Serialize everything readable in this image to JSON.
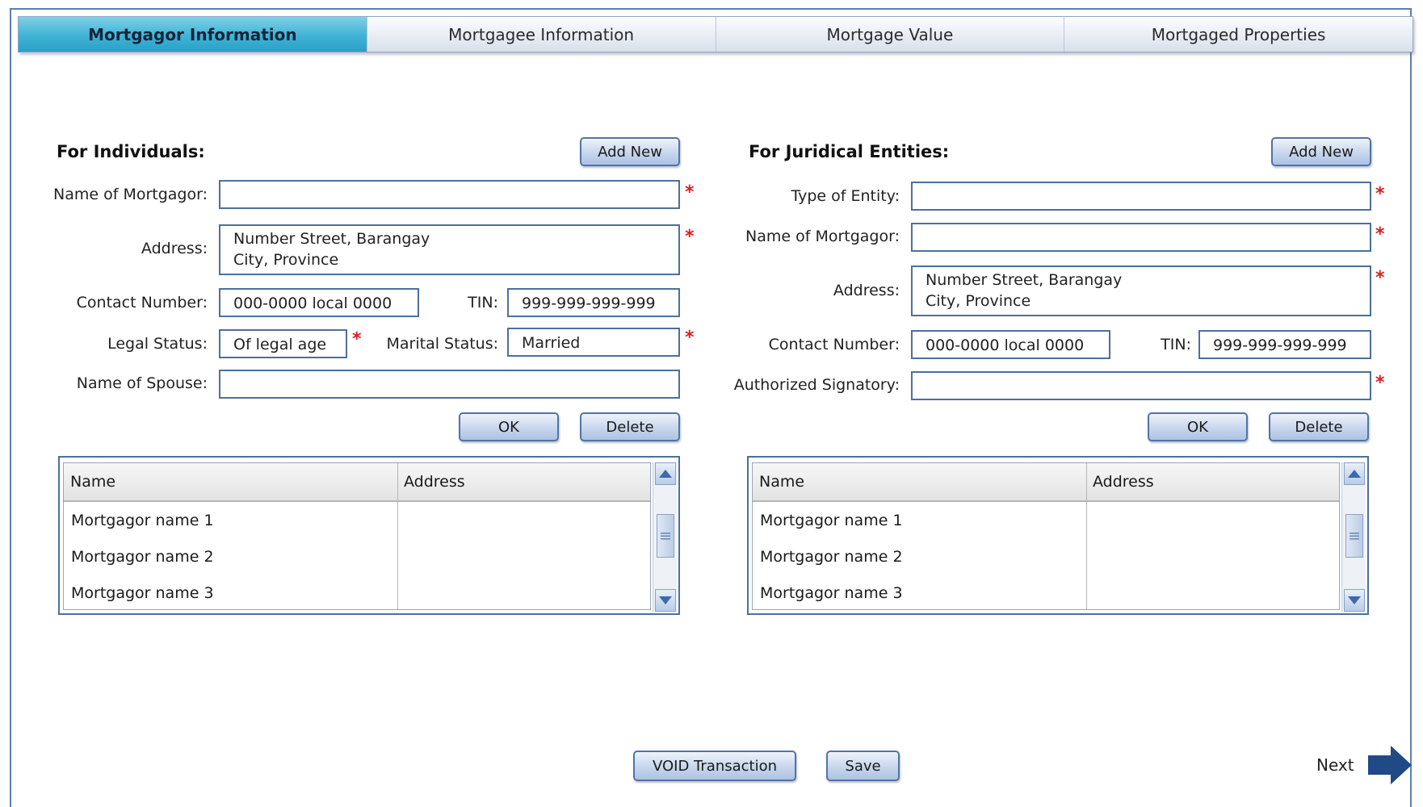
{
  "tabs": [
    {
      "label": "Mortgagor Information",
      "active": true
    },
    {
      "label": "Mortgagee Information",
      "active": false
    },
    {
      "label": "Mortgage Value",
      "active": false
    },
    {
      "label": "Mortgaged Properties",
      "active": false
    }
  ],
  "individuals": {
    "heading": "For Individuals:",
    "add_new": "Add New",
    "name_label": "Name of Mortgagor:",
    "name_value": "",
    "address_label": "Address:",
    "address_value": "Number Street, Barangay\nCity, Province",
    "contact_label": "Contact Number:",
    "contact_value": "000-0000 local 0000",
    "tin_label": "TIN:",
    "tin_value": "999-999-999-999",
    "legal_label": "Legal Status:",
    "legal_value": "Of legal age",
    "marital_label": "Marital Status:",
    "marital_value": "Married",
    "spouse_label": "Name of Spouse:",
    "spouse_value": "",
    "ok": "OK",
    "delete": "Delete",
    "table": {
      "columns": [
        "Name",
        "Address"
      ],
      "rows": [
        {
          "name": "Mortgagor name 1",
          "address": ""
        },
        {
          "name": "Mortgagor name 2",
          "address": ""
        },
        {
          "name": "Mortgagor name 3",
          "address": ""
        }
      ]
    }
  },
  "juridical": {
    "heading": "For Juridical Entities:",
    "add_new": "Add New",
    "type_label": "Type of Entity:",
    "type_value": "",
    "name_label": "Name of Mortgagor:",
    "name_value": "",
    "address_label": "Address:",
    "address_value": "Number Street, Barangay\nCity, Province",
    "contact_label": "Contact Number:",
    "contact_value": "000-0000 local 0000",
    "tin_label": "TIN:",
    "tin_value": "999-999-999-999",
    "signatory_label": "Authorized Signatory:",
    "signatory_value": "",
    "ok": "OK",
    "delete": "Delete",
    "table": {
      "columns": [
        "Name",
        "Address"
      ],
      "rows": [
        {
          "name": "Mortgagor name 1",
          "address": ""
        },
        {
          "name": "Mortgagor name 2",
          "address": ""
        },
        {
          "name": "Mortgagor name 3",
          "address": ""
        }
      ]
    }
  },
  "footer": {
    "void": "VOID Transaction",
    "save": "Save",
    "next": "Next"
  },
  "required_marker": "*",
  "colors": {
    "active_tab": "#3fb3d6",
    "border": "#4d6f9c",
    "required": "#e01e1e",
    "next_arrow": "#1f4a85"
  }
}
